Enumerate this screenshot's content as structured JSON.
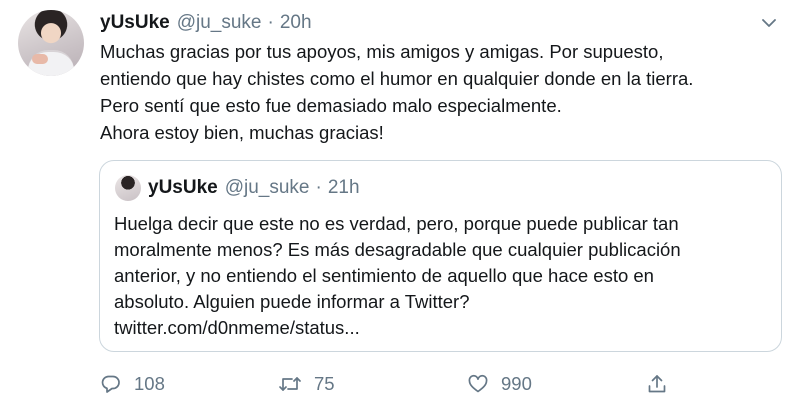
{
  "tweet": {
    "author_name": "yUsUke",
    "author_handle": "@ju_suke",
    "separator": "·",
    "time": "20h",
    "lines": [
      "Muchas gracias por tus apoyos, mis amigos y amigas. Por supuesto,",
      "entiendo que hay chistes como el humor en qualquier donde en la tierra.",
      "Pero sentí que esto fue demasiado malo especialmente.",
      "Ahora estoy bien, muchas gracias!"
    ]
  },
  "quoted": {
    "author_name": "yUsUke",
    "author_handle": "@ju_suke",
    "separator": "·",
    "time": "21h",
    "lines": [
      "Huelga decir que este no es verdad, pero, porque puede publicar tan",
      "moralmente menos? Es más desagradable que cualquier publicación",
      "anterior, y no entiendo el sentimiento de aquello que hace esto en",
      "absoluto. Alguien puede informar a Twitter?",
      "twitter.com/d0nmeme/status..."
    ]
  },
  "actions": {
    "reply_count": "108",
    "retweet_count": "75",
    "like_count": "990"
  },
  "colors": {
    "text": "#14171a",
    "secondary": "#657786",
    "border": "#ccd6dd"
  },
  "icons": [
    "chevron-down-icon",
    "reply-icon",
    "retweet-icon",
    "like-icon",
    "share-icon"
  ]
}
